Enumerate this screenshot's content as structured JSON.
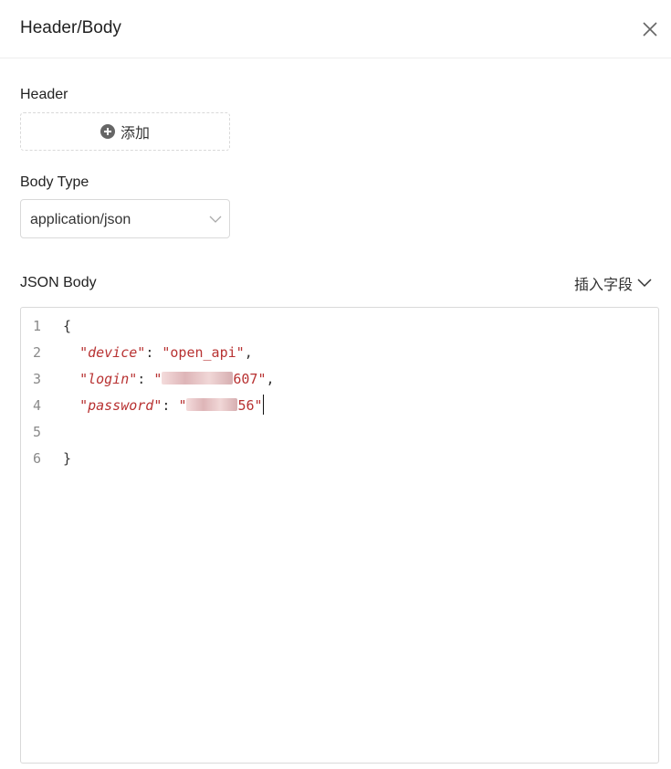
{
  "dialog": {
    "title": "Header/Body",
    "close_icon": "close-icon"
  },
  "header_section": {
    "label": "Header",
    "add_button_label": "添加",
    "add_icon": "plus-circle-icon"
  },
  "body_type": {
    "label": "Body Type",
    "selected_value": "application/json",
    "dropdown_icon": "chevron-down-icon"
  },
  "json_body": {
    "label": "JSON Body",
    "insert_field_label": "插入字段",
    "insert_field_icon": "chevron-down-icon",
    "lines": [
      {
        "number": "1",
        "text": "{"
      },
      {
        "number": "2",
        "key": "\"device\"",
        "sep": ": ",
        "value": "\"open_api\"",
        "tail": ","
      },
      {
        "number": "3",
        "key": "\"login\"",
        "sep": ": ",
        "value_start": "\"",
        "value_visible_end": "607\"",
        "tail": ","
      },
      {
        "number": "4",
        "key": "\"password\"",
        "sep": ": ",
        "value_start": "\"",
        "value_visible_end": "56\"",
        "tail": ""
      },
      {
        "number": "5",
        "text": ""
      },
      {
        "number": "6",
        "text": "}"
      }
    ]
  },
  "colors": {
    "string": "#b83232",
    "line_number": "#8a8a8a",
    "border": "#d9d9d9"
  }
}
